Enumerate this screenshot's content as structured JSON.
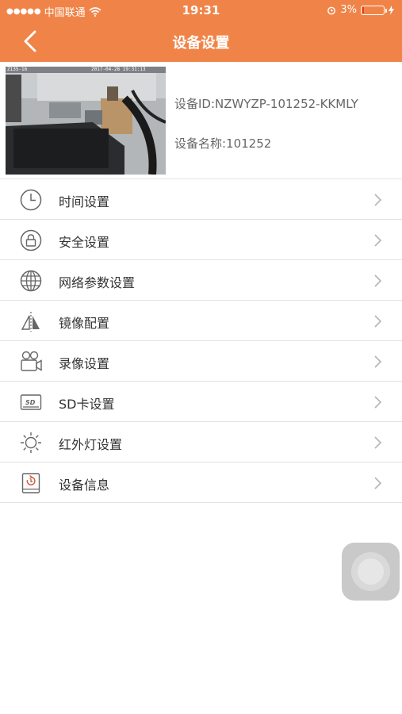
{
  "status_bar": {
    "signal_dots": "●●●●●",
    "carrier": "中国联通",
    "time": "19:31",
    "battery_percent": "3%",
    "battery_level": 0.03
  },
  "nav": {
    "title": "设备设置"
  },
  "device": {
    "id_label": "设备ID:NZWYZP-101252-KKMLY",
    "name_label": "设备名称:101252",
    "thumb_overlay_left": "Z135-16",
    "thumb_overlay_time": "2017-04-28 19:31:13"
  },
  "menu": [
    {
      "label": "时间设置",
      "icon": "clock-icon"
    },
    {
      "label": "安全设置",
      "icon": "lock-icon"
    },
    {
      "label": "网络参数设置",
      "icon": "globe-icon"
    },
    {
      "label": "镜像配置",
      "icon": "mirror-icon"
    },
    {
      "label": "录像设置",
      "icon": "video-camera-icon"
    },
    {
      "label": "SD卡设置",
      "icon": "sd-card-icon"
    },
    {
      "label": "红外灯设置",
      "icon": "sun-icon"
    },
    {
      "label": "设备信息",
      "icon": "device-info-icon"
    }
  ],
  "colors": {
    "header": "#f08448",
    "icon_stroke": "#666666",
    "chevron": "#b5b5b5"
  }
}
